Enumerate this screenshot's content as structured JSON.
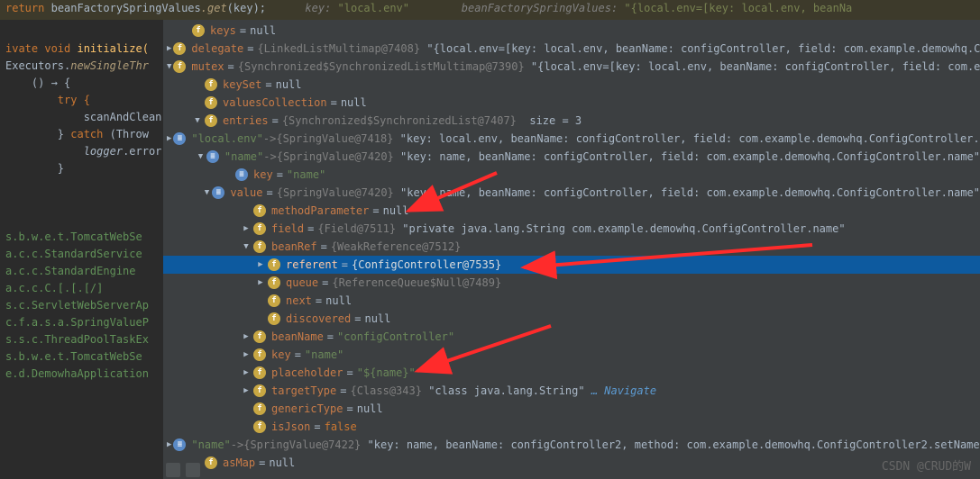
{
  "eval": {
    "ret": "return",
    "expr_obj": "beanFactorySpringValues",
    "expr_m": ".get",
    "expr_arg": "(key);",
    "hint1_k": "key: ",
    "hint1_v": "\"local.env\"",
    "hint2_k": "beanFactorySpringValues: ",
    "hint2_v": "\"{local.env=[key: local.env, beanNa"
  },
  "code": {
    "l1": "ivate void ",
    "l1m": "initialize(",
    "l2": "Executors.",
    "l2m": "newSingleThr",
    "l3": "    () → {",
    "l4": "        try {",
    "l5": "            scanAndClean",
    "l6a": "        } ",
    "l6b": "catch ",
    "l6c": "(Throw",
    "l7a": "            ",
    "l7b": "logger",
    "l7c": ".error",
    "l8": "        }",
    "s1": "s.b.w.e.t.TomcatWebSe",
    "s2": "a.c.c.StandardService",
    "s3": "a.c.c.StandardEngine",
    "s4": "a.c.c.C.[.[.[/]",
    "s5": "s.c.ServletWebServerAp",
    "s6": "c.f.a.s.a.SpringValueP",
    "s7": "s.s.c.ThreadPoolTaskEx",
    "s8": "s.b.w.e.t.TomcatWebSe",
    "s9": "e.d.DemowhaApplication"
  },
  "tree": {
    "keys": {
      "n": "keys",
      "v": "null"
    },
    "delegate": {
      "n": "delegate",
      "g": "{LinkedListMultimap@7408}",
      "v": "\"{local.env=[key: local.env, beanName: configController, field: com.example.demowhq.ConfigController.env"
    },
    "mutex": {
      "n": "mutex",
      "g": "{Synchronized$SynchronizedListMultimap@7390}",
      "v": "\"{local.env=[key: local.env, beanName: configController, field: com.example.demowhq.Co"
    },
    "keySet": {
      "n": "keySet",
      "v": "null"
    },
    "valuesCollection": {
      "n": "valuesCollection",
      "v": "null"
    },
    "entries": {
      "n": "entries",
      "g": "{Synchronized$SynchronizedList@7407}",
      "v": "size = 3"
    },
    "e0": {
      "k": "\"local.env\"",
      "arrow": " -> ",
      "g": "{SpringValue@7418}",
      "v": "\"key: local.env, beanName: configController, field: com.example.demowhq.ConfigController.env\""
    },
    "e1": {
      "k": "\"name\"",
      "arrow": " -> ",
      "g": "{SpringValue@7420}",
      "v": "\"key: name, beanName: configController, field: com.example.demowhq.ConfigController.name\""
    },
    "key": {
      "n": "key",
      "v": "\"name\""
    },
    "value": {
      "n": "value",
      "g": "{SpringValue@7420}",
      "v": "\"key: name, beanName: configController, field: com.example.demowhq.ConfigController.name\""
    },
    "methodParameter": {
      "n": "methodParameter",
      "v": "null"
    },
    "field": {
      "n": "field",
      "g": "{Field@7511}",
      "v": "\"private java.lang.String com.example.demowhq.ConfigController.name\""
    },
    "beanRef": {
      "n": "beanRef",
      "g": "{WeakReference@7512}"
    },
    "referent": {
      "n": "referent",
      "g": "{ConfigController@7535}"
    },
    "queue": {
      "n": "queue",
      "g": "{ReferenceQueue$Null@7489}"
    },
    "next": {
      "n": "next",
      "v": "null"
    },
    "discovered": {
      "n": "discovered",
      "v": "null"
    },
    "beanName": {
      "n": "beanName",
      "v": "\"configController\""
    },
    "key2": {
      "n": "key",
      "v": "\"name\""
    },
    "placeholder": {
      "n": "placeholder",
      "v": "\"${name}\""
    },
    "targetType": {
      "n": "targetType",
      "g": "{Class@343}",
      "v": "\"class java.lang.String\"",
      "nav": "… Navigate"
    },
    "genericType": {
      "n": "genericType",
      "v": "null"
    },
    "isJson": {
      "n": "isJson",
      "v": "false"
    },
    "e2": {
      "k": "\"name\"",
      "arrow": " -> ",
      "g": "{SpringValue@7422}",
      "v": "\"key: name, beanName: configController2, method: com.example.demowhq.ConfigController2.setName\""
    },
    "asMap": {
      "n": "asMap",
      "v": "null"
    }
  },
  "watermark": "CSDN @CRUD的W"
}
